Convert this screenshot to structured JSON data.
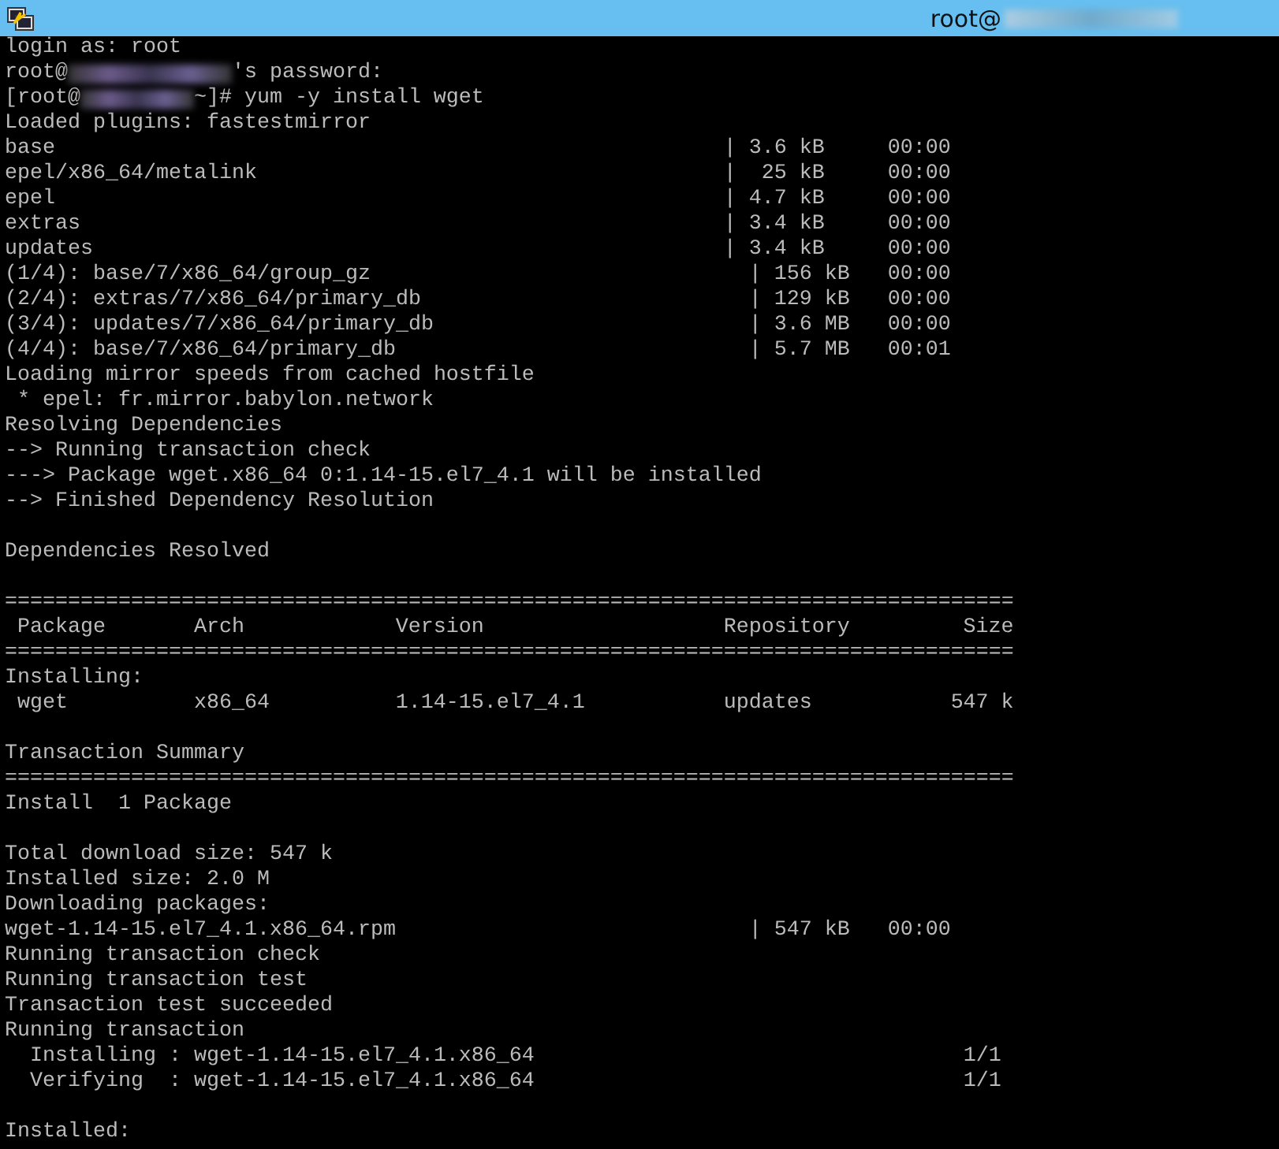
{
  "window": {
    "title": "root@"
  },
  "lines": [
    {
      "kind": "text",
      "text": "login as: root"
    },
    {
      "kind": "password-prompt",
      "before": "root@",
      "after": "'s password:"
    },
    {
      "kind": "shell-prompt",
      "before": "[root@",
      "after": "~]# yum -y install wget"
    },
    {
      "kind": "text",
      "text": "Loaded plugins: fastestmirror"
    },
    {
      "kind": "repo",
      "name": "base",
      "size": "| 3.6 kB",
      "time": "00:00"
    },
    {
      "kind": "repo",
      "name": "epel/x86_64/metalink",
      "size": "|  25 kB",
      "time": "00:00"
    },
    {
      "kind": "repo",
      "name": "epel",
      "size": "| 4.7 kB",
      "time": "00:00"
    },
    {
      "kind": "repo",
      "name": "extras",
      "size": "| 3.4 kB",
      "time": "00:00"
    },
    {
      "kind": "repo",
      "name": "updates",
      "size": "| 3.4 kB",
      "time": "00:00"
    },
    {
      "kind": "download",
      "name": "(1/4): base/7/x86_64/group_gz",
      "size": "| 156 kB",
      "time": "00:00"
    },
    {
      "kind": "download",
      "name": "(2/4): extras/7/x86_64/primary_db",
      "size": "| 129 kB",
      "time": "00:00"
    },
    {
      "kind": "download",
      "name": "(3/4): updates/7/x86_64/primary_db",
      "size": "| 3.6 MB",
      "time": "00:00"
    },
    {
      "kind": "download",
      "name": "(4/4): base/7/x86_64/primary_db",
      "size": "| 5.7 MB",
      "time": "00:01"
    },
    {
      "kind": "text",
      "text": "Loading mirror speeds from cached hostfile"
    },
    {
      "kind": "text",
      "text": " * epel: fr.mirror.babylon.network"
    },
    {
      "kind": "text",
      "text": "Resolving Dependencies"
    },
    {
      "kind": "text",
      "text": "--> Running transaction check"
    },
    {
      "kind": "text",
      "text": "---> Package wget.x86_64 0:1.14-15.el7_4.1 will be installed"
    },
    {
      "kind": "text",
      "text": "--> Finished Dependency Resolution"
    },
    {
      "kind": "blank"
    },
    {
      "kind": "text",
      "text": "Dependencies Resolved"
    },
    {
      "kind": "blank"
    },
    {
      "kind": "rule",
      "text": "================================================================================"
    },
    {
      "kind": "table-row",
      "cells": [
        "Package",
        "Arch",
        "Version",
        "Repository",
        "Size"
      ]
    },
    {
      "kind": "rule",
      "text": "================================================================================"
    },
    {
      "kind": "text",
      "text": "Installing:"
    },
    {
      "kind": "table-row",
      "cells": [
        "wget",
        "x86_64",
        "1.14-15.el7_4.1",
        "updates",
        "547 k"
      ]
    },
    {
      "kind": "blank"
    },
    {
      "kind": "text",
      "text": "Transaction Summary"
    },
    {
      "kind": "rule",
      "text": "================================================================================"
    },
    {
      "kind": "text",
      "text": "Install  1 Package"
    },
    {
      "kind": "blank"
    },
    {
      "kind": "text",
      "text": "Total download size: 547 k"
    },
    {
      "kind": "text",
      "text": "Installed size: 2.0 M"
    },
    {
      "kind": "text",
      "text": "Downloading packages:"
    },
    {
      "kind": "download",
      "name": "wget-1.14-15.el7_4.1.x86_64.rpm",
      "size": "| 547 kB",
      "time": "00:00"
    },
    {
      "kind": "text",
      "text": "Running transaction check"
    },
    {
      "kind": "text",
      "text": "Running transaction test"
    },
    {
      "kind": "text",
      "text": "Transaction test succeeded"
    },
    {
      "kind": "text",
      "text": "Running transaction"
    },
    {
      "kind": "step",
      "text": "  Installing : wget-1.14-15.el7_4.1.x86_64",
      "count": "1/1"
    },
    {
      "kind": "step",
      "text": "  Verifying  : wget-1.14-15.el7_4.1.x86_64",
      "count": "1/1"
    },
    {
      "kind": "blank"
    },
    {
      "kind": "text",
      "text": "Installed:"
    }
  ]
}
